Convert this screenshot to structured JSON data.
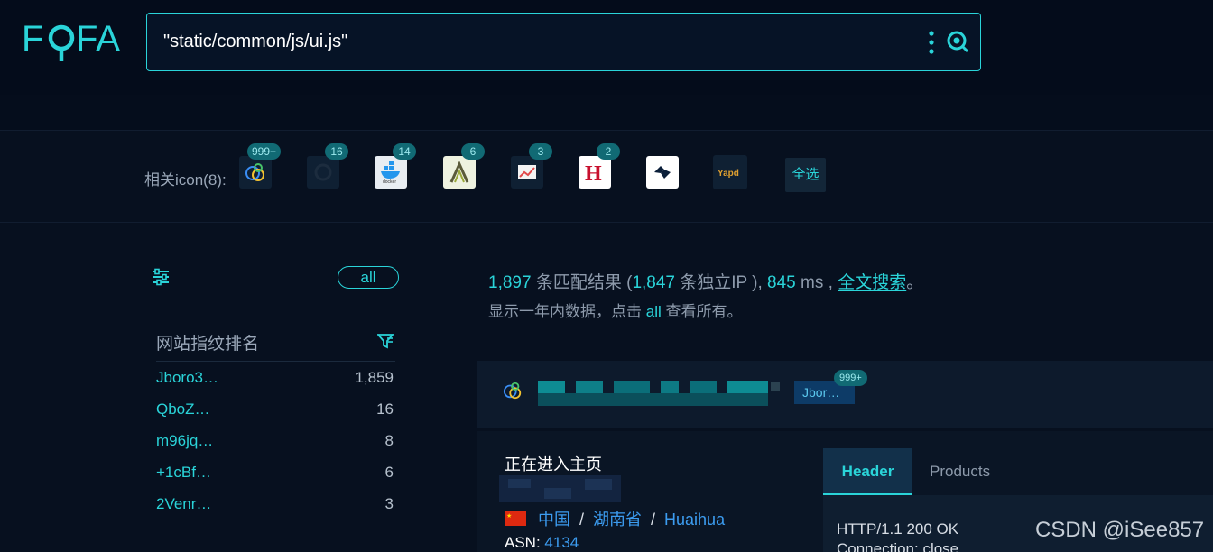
{
  "header": {
    "logo_text": "FOFA",
    "search_value": "\"static/common/js/ui.js\"",
    "more_icon": "vertical-dots-icon",
    "search_icon": "search-q-icon"
  },
  "icons": {
    "label": "相关icon(8):",
    "items": [
      {
        "name": "circles-logo-icon",
        "badge": "999+"
      },
      {
        "name": "dark-logo-icon",
        "badge": "16"
      },
      {
        "name": "docker-logo-icon",
        "badge": "14"
      },
      {
        "name": "lattice-logo-icon",
        "badge": "6"
      },
      {
        "name": "trend-logo-icon",
        "badge": "3"
      },
      {
        "name": "h-logo-icon",
        "badge": "2"
      },
      {
        "name": "diamond-logo-icon",
        "badge": ""
      },
      {
        "name": "yapd-logo-icon",
        "badge": "",
        "text": "Yapd"
      }
    ],
    "select_all": "全选"
  },
  "sidebar": {
    "all_label": "all",
    "rank_title": "网站指纹排名",
    "rank": [
      {
        "name": "Jboro3…",
        "count": "1,859"
      },
      {
        "name": "QboZ…",
        "count": "16"
      },
      {
        "name": "m96jq…",
        "count": "8"
      },
      {
        "name": "+1cBf…",
        "count": "6"
      },
      {
        "name": "2Venr…",
        "count": "3"
      }
    ]
  },
  "summary": {
    "total": "1,897",
    "t1": " 条匹配结果 (",
    "unique_ip": "1,847",
    "t2": " 条独立IP ), ",
    "ms": "845",
    "t3": " ms , ",
    "fulltext": "全文搜索",
    "t4": "。",
    "sub_pre": "显示一年内数据，点击 ",
    "sub_all": "all",
    "sub_post": " 查看所有。"
  },
  "result": {
    "tag": "Jbor…",
    "tag_badge": "999+",
    "page_title": "正在进入主页",
    "country": "中国",
    "province": "湖南省",
    "city": "Huaihua",
    "sep": "/",
    "asn_label": "ASN:",
    "asn": "4134",
    "tabs": [
      "Header",
      "Products"
    ],
    "http_line1": "HTTP/1.1 200 OK",
    "http_line2": "Connection: close"
  },
  "watermark": "CSDN @iSee857",
  "colors": {
    "accent": "#2ad4d9",
    "link": "#3c9cf0",
    "background": "#07101f"
  }
}
